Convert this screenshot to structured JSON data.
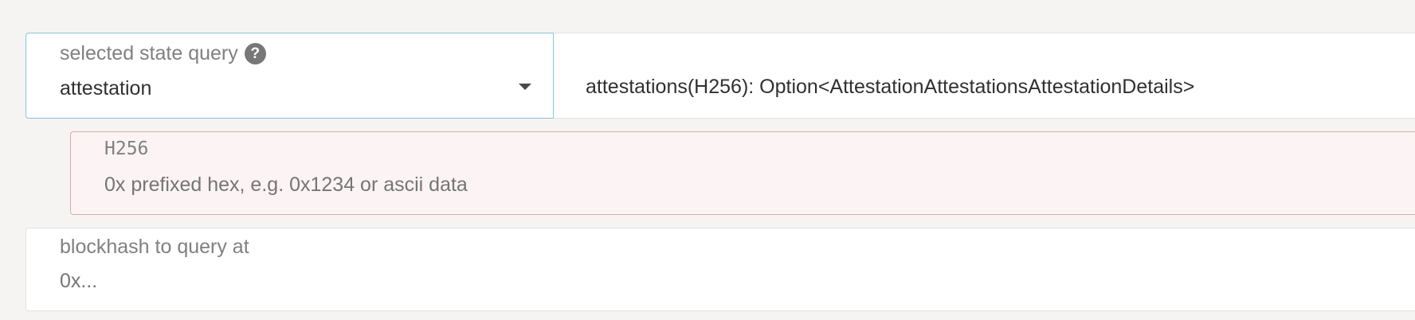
{
  "query_selector": {
    "label": "selected state query",
    "help_icon_glyph": "?",
    "selected_value": "attestation",
    "caret_icon": "chevron-down-icon",
    "border_color": "#89c4d8"
  },
  "signature": {
    "text": "attestations(H256): Option<AttestationAttestationsAttestationDetails>"
  },
  "param": {
    "label": "H256",
    "value": "",
    "placeholder": "0x prefixed hex, e.g. 0x1234 or ascii data",
    "state": "error",
    "error_bg": "#fcf4f4",
    "error_border": "#dcaaaa"
  },
  "blockhash": {
    "label": "blockhash to query at",
    "value": "",
    "placeholder": "0x..."
  }
}
